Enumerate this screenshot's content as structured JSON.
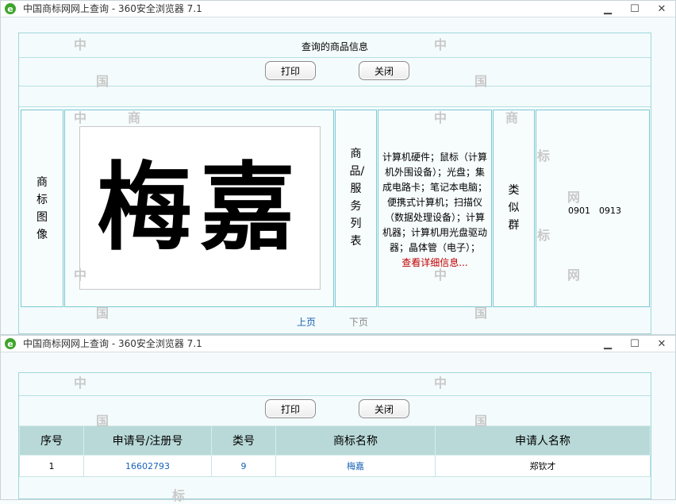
{
  "window": {
    "title": "中国商标网网上查询 - 360安全浏览器 7.1",
    "controls": [
      "▁",
      "☐",
      "✕"
    ]
  },
  "detail": {
    "heading": "查询的商品信息",
    "print_label": "打印",
    "close_label": "关闭",
    "trademark_image_label": "商标图像",
    "trademark_text": "梅嘉",
    "goods_label": "商品/服务列表",
    "goods_list": "计算机硬件；鼠标（计算机外围设备）；光盘；集成电路卡；笔记本电脑；便携式计算机；扫描仪（数据处理设备）；计算机器；计算机用光盘驱动器；晶体管（电子）；",
    "view_more": "查看详细信息...",
    "similar_group_label": "类似群",
    "similar_groups": "0901　0913",
    "prev_page": "上页",
    "next_page": "下页"
  },
  "results": {
    "print_label": "打印",
    "close_label": "关闭",
    "columns": [
      "序号",
      "申请号/注册号",
      "类号",
      "商标名称",
      "申请人名称"
    ],
    "rows": [
      {
        "index": "1",
        "reg_no": "16602793",
        "class": "9",
        "name": "梅嘉",
        "applicant": "郑钦才"
      }
    ]
  },
  "watermarks": {
    "zhong": "中",
    "guo": "国",
    "shang": "商",
    "biao": "标",
    "wang": "网"
  },
  "colors": {
    "border": "#7cc9d3",
    "header_bg": "#b8d9d8",
    "link": "#1a63b5",
    "detail_link": "#c00000"
  }
}
